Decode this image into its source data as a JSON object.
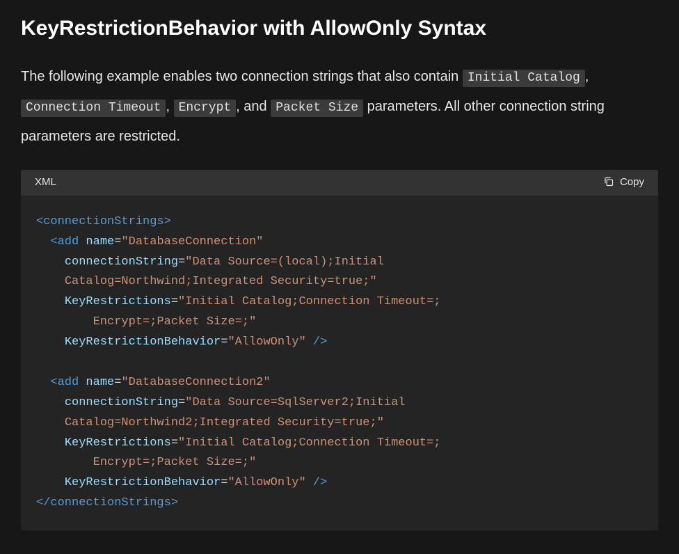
{
  "heading": "KeyRestrictionBehavior with AllowOnly Syntax",
  "intro": {
    "t1": "The following example enables two connection strings that also contain ",
    "c1": "Initial Catalog",
    "t2": ", ",
    "c2": "Connection Timeout",
    "t3": ", ",
    "c3": "Encrypt",
    "t4": ", and ",
    "c4": "Packet Size",
    "t5": " parameters. All other connection string parameters are restricted."
  },
  "code": {
    "lang": "XML",
    "copy_label": "Copy",
    "el_open": "connectionStrings",
    "el_close": "connectionStrings",
    "el_add": "add",
    "attr_name": "name",
    "attr_conn": "connectionString",
    "attr_keyr": "KeyRestrictions",
    "attr_krb": "KeyRestrictionBehavior",
    "e1": {
      "name": "DatabaseConnection",
      "conn_l1": "Data Source=(local);Initial ",
      "conn_l2": "Catalog=Northwind;Integrated Security=true;",
      "keyr_l1": "Initial Catalog;Connection Timeout=;",
      "keyr_l2": "Encrypt=;Packet Size=;",
      "krb": "AllowOnly"
    },
    "e2": {
      "name": "DatabaseConnection2",
      "conn_l1": "Data Source=SqlServer2;Initial ",
      "conn_l2": "Catalog=Northwind2;Integrated Security=true;",
      "keyr_l1": "Initial Catalog;Connection Timeout=;",
      "keyr_l2": "Encrypt=;Packet Size=;",
      "krb": "AllowOnly"
    }
  }
}
